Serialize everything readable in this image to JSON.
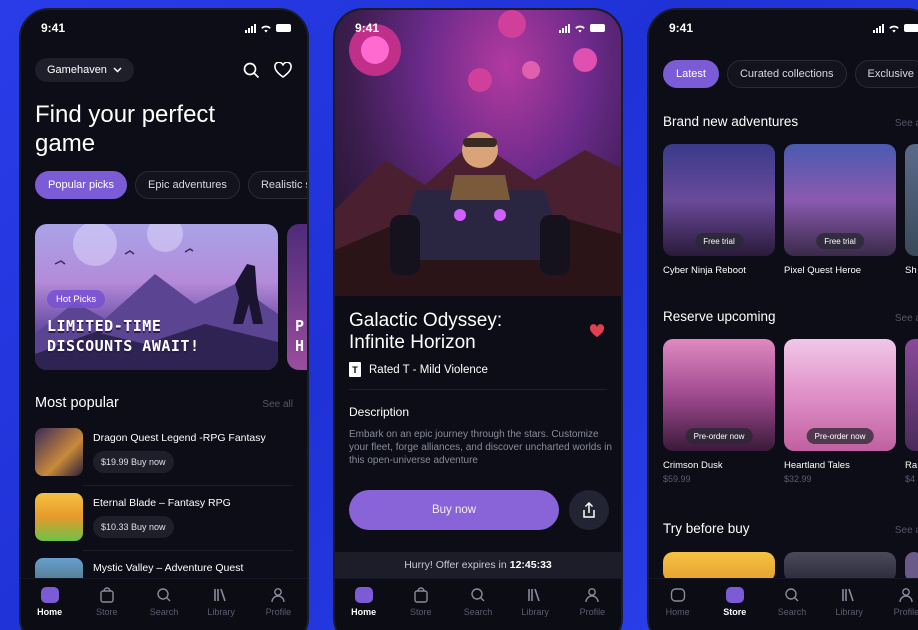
{
  "status_time": "9:41",
  "colors": {
    "accent": "#7b5cd6",
    "background": "#0c0d16",
    "page_bg": "#2a3ce8"
  },
  "screen1": {
    "store_selector": "Gamehaven",
    "headline": "Find your perfect game",
    "chips": [
      "Popular picks",
      "Epic adventures",
      "Realistic s"
    ],
    "banner": {
      "badge": "Hot Picks",
      "line1": "LIMITED-TIME",
      "line2": "DISCOUNTS AWAIT!",
      "peek1": "P",
      "peek2": "H"
    },
    "most_popular": {
      "title": "Most popular",
      "see_all": "See all",
      "items": [
        {
          "name": "Dragon Quest Legend -RPG Fantasy",
          "price": "$19.99 Buy now"
        },
        {
          "name": "Eternal Blade – Fantasy RPG",
          "price": "$10.33 Buy now"
        },
        {
          "name": "Mystic Valley – Adventure Quest",
          "price": ""
        }
      ]
    }
  },
  "screen2": {
    "title": "Galactic Odyssey: Infinite Horizon",
    "rating_icon": "T",
    "rating": "Rated T - Mild Violence",
    "description_title": "Description",
    "description": "Embark on an epic journey through the stars. Customize your fleet, forge alliances, and discover uncharted worlds in this open-universe adventure",
    "buy_label": "Buy now",
    "offer_prefix": "Hurry! Offer expires in",
    "offer_time": "12:45:33"
  },
  "screen3": {
    "tabs": [
      "Latest",
      "Curated collections",
      "Exclusive"
    ],
    "sections": [
      {
        "title": "Brand new adventures",
        "see_all": "See a",
        "cards": [
          {
            "name": "Cyber Ninja Reboot",
            "tag": "Free trial",
            "price": ""
          },
          {
            "name": "Pixel Quest Heroe",
            "tag": "Free trial",
            "price": ""
          },
          {
            "name": "Sh",
            "tag": "",
            "price": ""
          }
        ]
      },
      {
        "title": "Reserve upcoming",
        "see_all": "See a",
        "cards": [
          {
            "name": "Crimson Dusk",
            "tag": "Pre-order now",
            "price": "$59.99"
          },
          {
            "name": "Heartland Tales",
            "tag": "Pre-order now",
            "price": "$32.99"
          },
          {
            "name": "Ra",
            "tag": "",
            "price": "$4"
          }
        ]
      },
      {
        "title": "Try before buy",
        "see_all": "See a"
      }
    ]
  },
  "nav": [
    "Home",
    "Store",
    "Search",
    "Library",
    "Profile"
  ]
}
